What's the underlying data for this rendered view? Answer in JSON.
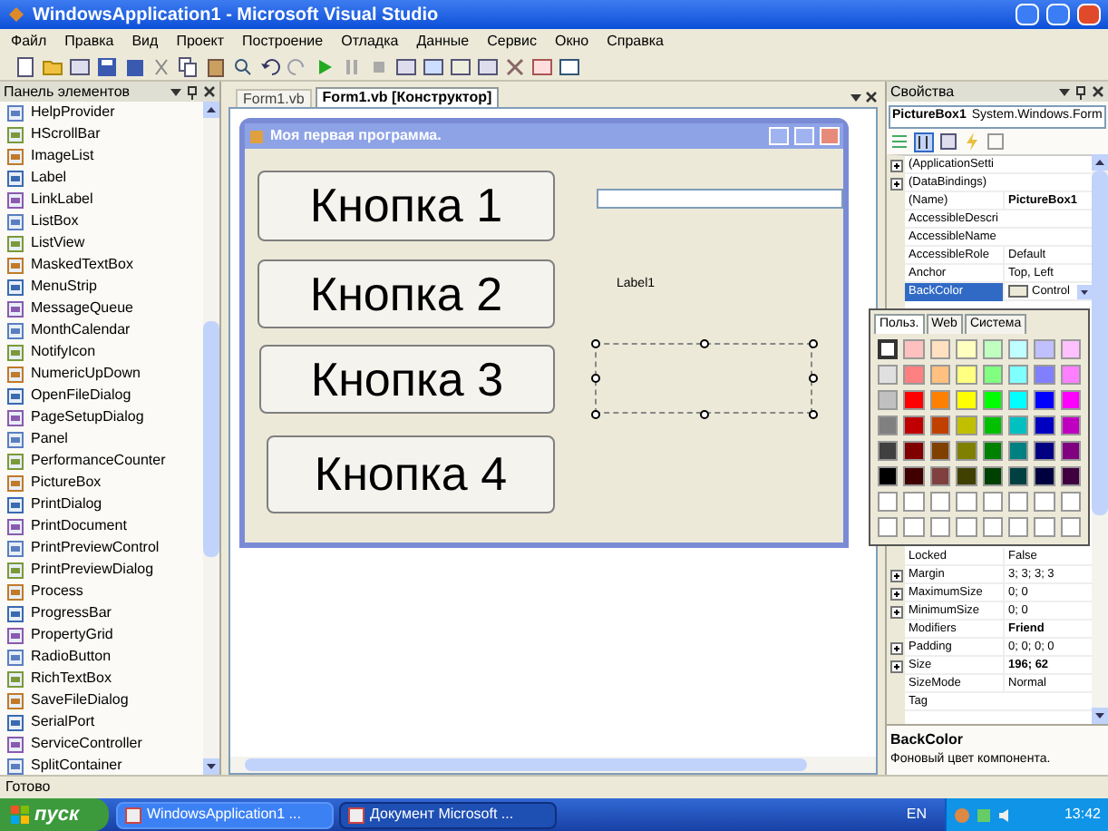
{
  "window": {
    "title": "WindowsApplication1 - Microsoft Visual Studio"
  },
  "menu": [
    "Файл",
    "Правка",
    "Вид",
    "Проект",
    "Построение",
    "Отладка",
    "Данные",
    "Сервис",
    "Окно",
    "Справка"
  ],
  "toolbox": {
    "title": "Панель элементов",
    "items": [
      "HelpProvider",
      "HScrollBar",
      "ImageList",
      "Label",
      "LinkLabel",
      "ListBox",
      "ListView",
      "MaskedTextBox",
      "MenuStrip",
      "MessageQueue",
      "MonthCalendar",
      "NotifyIcon",
      "NumericUpDown",
      "OpenFileDialog",
      "PageSetupDialog",
      "Panel",
      "PerformanceCounter",
      "PictureBox",
      "PrintDialog",
      "PrintDocument",
      "PrintPreviewControl",
      "PrintPreviewDialog",
      "Process",
      "ProgressBar",
      "PropertyGrid",
      "RadioButton",
      "RichTextBox",
      "SaveFileDialog",
      "SerialPort",
      "ServiceController",
      "SplitContainer"
    ]
  },
  "tabs": [
    {
      "label": "Form1.vb",
      "selected": false
    },
    {
      "label": "Form1.vb [Конструктор]",
      "selected": true
    }
  ],
  "form": {
    "title": "Моя первая программа.",
    "buttons": [
      "Кнопка 1",
      "Кнопка 2",
      "Кнопка 3",
      "Кнопка 4"
    ],
    "label": "Label1"
  },
  "properties": {
    "title": "Свойства",
    "object": "PictureBox1",
    "object_type": "System.Windows.Form",
    "rows_top": [
      {
        "name": "(ApplicationSetti",
        "kind": "group",
        "selected": false
      },
      {
        "name": "(DataBindings)",
        "kind": "group",
        "selected": false
      },
      {
        "name": "(Name)",
        "value": "PictureBox1",
        "kind": "plain",
        "non_default": true,
        "selected": false
      },
      {
        "name": "AccessibleDescri",
        "kind": "plain",
        "selected": false
      },
      {
        "name": "AccessibleName",
        "kind": "plain",
        "selected": false
      },
      {
        "name": "AccessibleRole",
        "value": "Default",
        "kind": "plain",
        "non_default": false,
        "selected": false
      },
      {
        "name": "Anchor",
        "value": "Top, Left",
        "kind": "plain",
        "non_default": false,
        "selected": false
      },
      {
        "name": "BackColor",
        "value": "Control",
        "kind": "color",
        "non_default": false,
        "selected": true
      }
    ],
    "rows_bottom": [
      {
        "name": "Locked",
        "value": "False",
        "kind": "plain",
        "non_default": false,
        "selected": false
      },
      {
        "name": "Margin",
        "value": "3; 3; 3; 3",
        "kind": "group",
        "non_default": false,
        "selected": false
      },
      {
        "name": "MaximumSize",
        "value": "0; 0",
        "kind": "group",
        "non_default": false,
        "selected": false
      },
      {
        "name": "MinimumSize",
        "value": "0; 0",
        "kind": "group",
        "non_default": false,
        "selected": false
      },
      {
        "name": "Modifiers",
        "value": "Friend",
        "kind": "plain",
        "non_default": true,
        "selected": false
      },
      {
        "name": "Padding",
        "value": "0; 0; 0; 0",
        "kind": "group",
        "non_default": false,
        "selected": false
      },
      {
        "name": "Size",
        "value": "196; 62",
        "kind": "group",
        "non_default": true,
        "selected": false
      },
      {
        "name": "SizeMode",
        "value": "Normal",
        "kind": "plain",
        "non_default": false,
        "selected": false
      },
      {
        "name": "Tag",
        "kind": "plain",
        "selected": false
      }
    ],
    "description": {
      "title": "BackColor",
      "text": "Фоновый цвет компонента."
    }
  },
  "color_picker": {
    "tabs": [
      {
        "label": "Польз.",
        "selected": true
      },
      {
        "label": "Web",
        "selected": false
      },
      {
        "label": "Система",
        "selected": false
      }
    ],
    "swatches": [
      {
        "color": "#ffffff",
        "selected": true
      },
      {
        "color": "#ffc0c0",
        "selected": false
      },
      {
        "color": "#ffe0c0",
        "selected": false
      },
      {
        "color": "#ffffc0",
        "selected": false
      },
      {
        "color": "#c0ffc0",
        "selected": false
      },
      {
        "color": "#c0ffff",
        "selected": false
      },
      {
        "color": "#c0c0ff",
        "selected": false
      },
      {
        "color": "#ffc0ff",
        "selected": false
      },
      {
        "color": "#e0e0e0",
        "selected": false
      },
      {
        "color": "#ff8080",
        "selected": false
      },
      {
        "color": "#ffc080",
        "selected": false
      },
      {
        "color": "#ffff80",
        "selected": false
      },
      {
        "color": "#80ff80",
        "selected": false
      },
      {
        "color": "#80ffff",
        "selected": false
      },
      {
        "color": "#8080ff",
        "selected": false
      },
      {
        "color": "#ff80ff",
        "selected": false
      },
      {
        "color": "#c0c0c0",
        "selected": false
      },
      {
        "color": "#ff0000",
        "selected": false
      },
      {
        "color": "#ff8000",
        "selected": false
      },
      {
        "color": "#ffff00",
        "selected": false
      },
      {
        "color": "#00ff00",
        "selected": false
      },
      {
        "color": "#00ffff",
        "selected": false
      },
      {
        "color": "#0000ff",
        "selected": false
      },
      {
        "color": "#ff00ff",
        "selected": false
      },
      {
        "color": "#808080",
        "selected": false
      },
      {
        "color": "#c00000",
        "selected": false
      },
      {
        "color": "#c04000",
        "selected": false
      },
      {
        "color": "#c0c000",
        "selected": false
      },
      {
        "color": "#00c000",
        "selected": false
      },
      {
        "color": "#00c0c0",
        "selected": false
      },
      {
        "color": "#0000c0",
        "selected": false
      },
      {
        "color": "#c000c0",
        "selected": false
      },
      {
        "color": "#404040",
        "selected": false
      },
      {
        "color": "#800000",
        "selected": false
      },
      {
        "color": "#804000",
        "selected": false
      },
      {
        "color": "#808000",
        "selected": false
      },
      {
        "color": "#008000",
        "selected": false
      },
      {
        "color": "#008080",
        "selected": false
      },
      {
        "color": "#000080",
        "selected": false
      },
      {
        "color": "#800080",
        "selected": false
      },
      {
        "color": "#000000",
        "selected": false
      },
      {
        "color": "#400000",
        "selected": false
      },
      {
        "color": "#804040",
        "selected": false
      },
      {
        "color": "#404000",
        "selected": false
      },
      {
        "color": "#004000",
        "selected": false
      },
      {
        "color": "#004040",
        "selected": false
      },
      {
        "color": "#000040",
        "selected": false
      },
      {
        "color": "#400040",
        "selected": false
      },
      {
        "color": "#ffffff",
        "selected": false
      },
      {
        "color": "#ffffff",
        "selected": false
      },
      {
        "color": "#ffffff",
        "selected": false
      },
      {
        "color": "#ffffff",
        "selected": false
      },
      {
        "color": "#ffffff",
        "selected": false
      },
      {
        "color": "#ffffff",
        "selected": false
      },
      {
        "color": "#ffffff",
        "selected": false
      },
      {
        "color": "#ffffff",
        "selected": false
      },
      {
        "color": "#ffffff",
        "selected": false
      },
      {
        "color": "#ffffff",
        "selected": false
      },
      {
        "color": "#ffffff",
        "selected": false
      },
      {
        "color": "#ffffff",
        "selected": false
      },
      {
        "color": "#ffffff",
        "selected": false
      },
      {
        "color": "#ffffff",
        "selected": false
      },
      {
        "color": "#ffffff",
        "selected": false
      },
      {
        "color": "#ffffff",
        "selected": false
      }
    ]
  },
  "status_bar": "Готово",
  "taskbar": {
    "start": "пуск",
    "tasks": [
      {
        "label": "WindowsApplication1 ...",
        "selected": false
      },
      {
        "label": "Документ Microsoft ...",
        "selected": true
      }
    ],
    "language": "EN",
    "time": "13:42"
  }
}
